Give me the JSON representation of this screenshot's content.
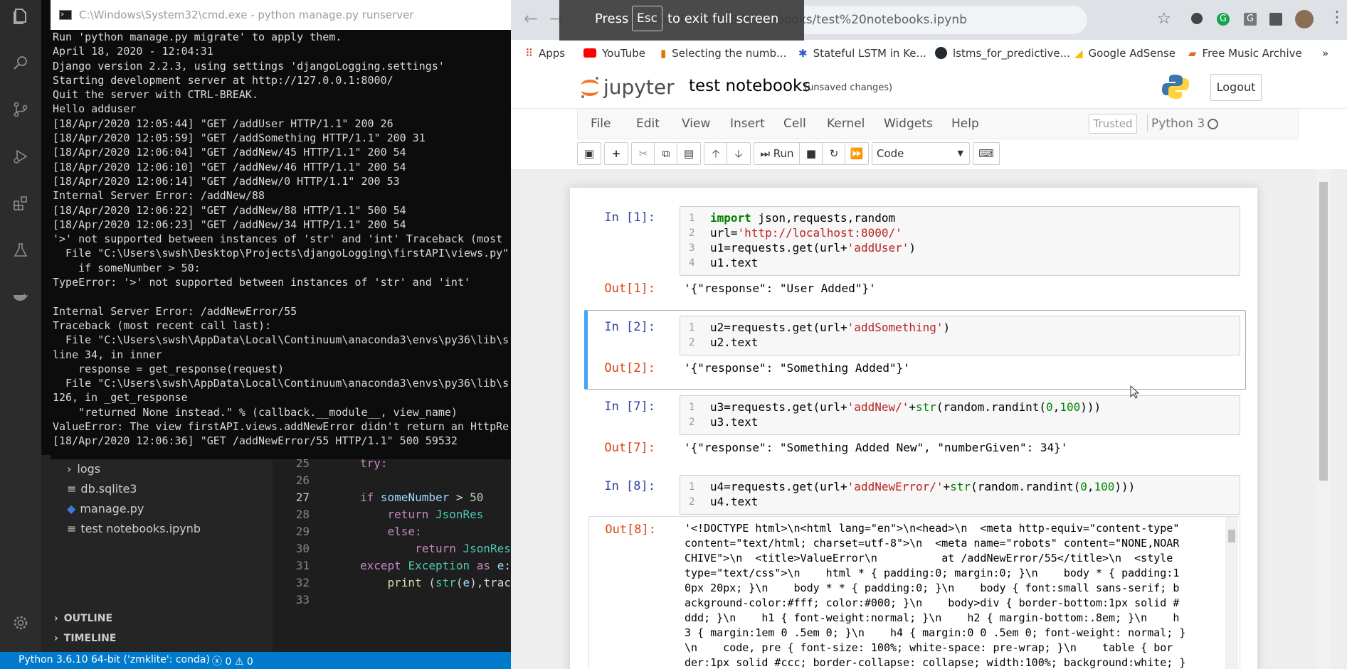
{
  "colors": {
    "vscode_status": "#007acc",
    "jupyter_selected": "#42a5f5",
    "cmd_bg": "#0c0c0c"
  },
  "vscode": {
    "activity_icons": [
      "files-icon",
      "search-icon",
      "source-control-icon",
      "run-debug-icon",
      "extensions-icon",
      "flask-icon",
      "docker-icon",
      "settings-gear-icon"
    ],
    "tree": [
      {
        "label": "logs",
        "icon": "chevron-right-icon"
      },
      {
        "label": "db.sqlite3",
        "icon": "file-icon"
      },
      {
        "label": "manage.py",
        "icon": "python-file-icon"
      },
      {
        "label": "test notebooks.ipynb",
        "icon": "file-icon"
      }
    ],
    "outline_label": "OUTLINE",
    "timeline_label": "TIMELINE",
    "code_lines": [
      {
        "n": "25",
        "text": "try:"
      },
      {
        "n": "26",
        "text": ""
      },
      {
        "n": "27",
        "text": "    if someNumber > 50"
      },
      {
        "n": "28",
        "text": "        return JsonRes"
      },
      {
        "n": "29",
        "text": "    else:"
      },
      {
        "n": "30",
        "text": "        return JsonRes"
      },
      {
        "n": "31",
        "text": "except Exception as e:"
      },
      {
        "n": "32",
        "text": "    print (str(e),trac"
      },
      {
        "n": "33",
        "text": ""
      }
    ],
    "status_interpreter": "Python 3.6.10 64-bit ('zmklite': conda)",
    "status_errors": "0",
    "status_warnings": "0"
  },
  "cmd": {
    "title": "C:\\Windows\\System32\\cmd.exe - python  manage.py runserver",
    "lines": [
      "Run 'python manage.py migrate' to apply them.",
      "April 18, 2020 - 12:04:31",
      "Django version 2.2.3, using settings 'djangoLogging.settings'",
      "Starting development server at http://127.0.0.1:8000/",
      "Quit the server with CTRL-BREAK.",
      "Hello adduser",
      "[18/Apr/2020 12:05:44] \"GET /addUser HTTP/1.1\" 200 26",
      "[18/Apr/2020 12:05:59] \"GET /addSomething HTTP/1.1\" 200 31",
      "[18/Apr/2020 12:06:04] \"GET /addNew/45 HTTP/1.1\" 200 54",
      "[18/Apr/2020 12:06:10] \"GET /addNew/46 HTTP/1.1\" 200 54",
      "[18/Apr/2020 12:06:14] \"GET /addNew/0 HTTP/1.1\" 200 53",
      "Internal Server Error: /addNew/88",
      "[18/Apr/2020 12:06:22] \"GET /addNew/88 HTTP/1.1\" 500 54",
      "[18/Apr/2020 12:06:23] \"GET /addNew/34 HTTP/1.1\" 200 54",
      "'>' not supported between instances of 'str' and 'int' Traceback (most",
      "  File \"C:\\Users\\swsh\\Desktop\\Projects\\djangoLogging\\firstAPI\\views.py\"",
      "    if someNumber > 50:",
      "TypeError: '>' not supported between instances of 'str' and 'int'",
      "",
      "Internal Server Error: /addNewError/55",
      "Traceback (most recent call last):",
      "  File \"C:\\Users\\swsh\\AppData\\Local\\Continuum\\anaconda3\\envs\\py36\\lib\\s",
      "line 34, in inner",
      "    response = get_response(request)",
      "  File \"C:\\Users\\swsh\\AppData\\Local\\Continuum\\anaconda3\\envs\\py36\\lib\\s",
      "126, in _get_response",
      "    \"returned None instead.\" % (callback.__module__, view_name)",
      "ValueError: The view firstAPI.views.addNewError didn't return an HttpRe",
      "[18/Apr/2020 12:06:36] \"GET /addNewError/55 HTTP/1.1\" 500 59532"
    ]
  },
  "browser": {
    "address_text": "localhost:8888/notebooks/test%20notebooks.ipynb",
    "fullscreen_press": "Press",
    "fullscreen_key": "Esc",
    "fullscreen_rest": "to exit full screen",
    "bookmarks": [
      {
        "label": "Apps",
        "icon": "apps-grid-icon"
      },
      {
        "label": "YouTube",
        "icon": "youtube-icon"
      },
      {
        "label": "Selecting the numb...",
        "icon": "chart-icon"
      },
      {
        "label": "Stateful LSTM in Ke...",
        "icon": "bookmark-icon"
      },
      {
        "label": "lstms_for_predictive...",
        "icon": "github-icon"
      },
      {
        "label": "Google AdSense",
        "icon": "adsense-icon"
      },
      {
        "label": "Free Music Archive",
        "icon": "music-icon"
      }
    ],
    "overflow": "»"
  },
  "jupyter": {
    "logo_text": "jupyter",
    "notebook_name": "test notebooks",
    "save_status": "(unsaved changes)",
    "logout_label": "Logout",
    "menu": [
      "File",
      "Edit",
      "View",
      "Insert",
      "Cell",
      "Kernel",
      "Widgets",
      "Help"
    ],
    "trusted_label": "Trusted",
    "kernel_name": "Python 3",
    "run_label": "Run",
    "cell_type": "Code",
    "cells": [
      {
        "in_prompt": "In [1]:",
        "code": [
          [
            {
              "t": "import",
              "c": "kw"
            },
            {
              "t": " json,requests,random",
              "c": ""
            }
          ],
          [
            {
              "t": "url",
              "c": ""
            },
            {
              "t": "=",
              "c": ""
            },
            {
              "t": "'http://localhost:8000/'",
              "c": "str"
            }
          ],
          [
            {
              "t": "u1",
              "c": ""
            },
            {
              "t": "=",
              "c": ""
            },
            {
              "t": "requests.get(url",
              "c": ""
            },
            {
              "t": "+",
              "c": ""
            },
            {
              "t": "'addUser'",
              "c": "str"
            },
            {
              "t": ")",
              "c": ""
            }
          ],
          [
            {
              "t": "u1.text",
              "c": ""
            }
          ]
        ],
        "out_prompt": "Out[1]:",
        "output": "'{\"response\": \"User Added\"}'"
      },
      {
        "in_prompt": "In [2]:",
        "code": [
          [
            {
              "t": "u2",
              "c": ""
            },
            {
              "t": "=",
              "c": ""
            },
            {
              "t": "requests.get(url",
              "c": ""
            },
            {
              "t": "+",
              "c": ""
            },
            {
              "t": "'addSomething'",
              "c": "str"
            },
            {
              "t": ")",
              "c": ""
            }
          ],
          [
            {
              "t": "u2.text",
              "c": ""
            }
          ]
        ],
        "out_prompt": "Out[2]:",
        "output": "'{\"response\": \"Something Added\"}'"
      },
      {
        "in_prompt": "In [7]:",
        "code": [
          [
            {
              "t": "u3",
              "c": ""
            },
            {
              "t": "=",
              "c": ""
            },
            {
              "t": "requests.get(url",
              "c": ""
            },
            {
              "t": "+",
              "c": ""
            },
            {
              "t": "'addNew/'",
              "c": "str"
            },
            {
              "t": "+",
              "c": ""
            },
            {
              "t": "str",
              "c": "bi"
            },
            {
              "t": "(random.randint(",
              "c": ""
            },
            {
              "t": "0",
              "c": "num"
            },
            {
              "t": ",",
              "c": ""
            },
            {
              "t": "100",
              "c": "num"
            },
            {
              "t": ")))",
              "c": ""
            }
          ],
          [
            {
              "t": "u3.text",
              "c": ""
            }
          ]
        ],
        "out_prompt": "Out[7]:",
        "output": "'{\"response\": \"Something Added New\", \"numberGiven\": 34}'"
      },
      {
        "in_prompt": "In [8]:",
        "code": [
          [
            {
              "t": "u4",
              "c": ""
            },
            {
              "t": "=",
              "c": ""
            },
            {
              "t": "requests.get(url",
              "c": ""
            },
            {
              "t": "+",
              "c": ""
            },
            {
              "t": "'addNewError/'",
              "c": "str"
            },
            {
              "t": "+",
              "c": ""
            },
            {
              "t": "str",
              "c": "bi"
            },
            {
              "t": "(random.randint(",
              "c": ""
            },
            {
              "t": "0",
              "c": "num"
            },
            {
              "t": ",",
              "c": ""
            },
            {
              "t": "100",
              "c": "num"
            },
            {
              "t": ")))",
              "c": ""
            }
          ],
          [
            {
              "t": "u4.text",
              "c": ""
            }
          ]
        ],
        "out_prompt": "Out[8]:",
        "output_lines": [
          "'<!DOCTYPE html>\\n<html lang=\"en\">\\n<head>\\n  <meta http-equiv=\"content-type\"",
          "content=\"text/html; charset=utf-8\">\\n  <meta name=\"robots\" content=\"NONE,NOAR",
          "CHIVE\">\\n  <title>ValueError\\n          at /addNewError/55</title>\\n  <style",
          "type=\"text/css\">\\n    html * { padding:0; margin:0; }\\n    body * { padding:1",
          "0px 20px; }\\n    body * * { padding:0; }\\n    body { font:small sans-serif; b",
          "ackground-color:#fff; color:#000; }\\n    body>div { border-bottom:1px solid #",
          "ddd; }\\n    h1 { font-weight:normal; }\\n    h2 { margin-bottom:.8em; }\\n    h",
          "3 { margin:1em 0 .5em 0; }\\n    h4 { margin:0 0 .5em 0; font-weight: normal; }",
          "\\n    code, pre { font-size: 100%; white-space: pre-wrap; }\\n    table { bor",
          "der:1px solid #ccc; border-collapse: collapse; width:100%; background:white; }"
        ]
      }
    ]
  }
}
